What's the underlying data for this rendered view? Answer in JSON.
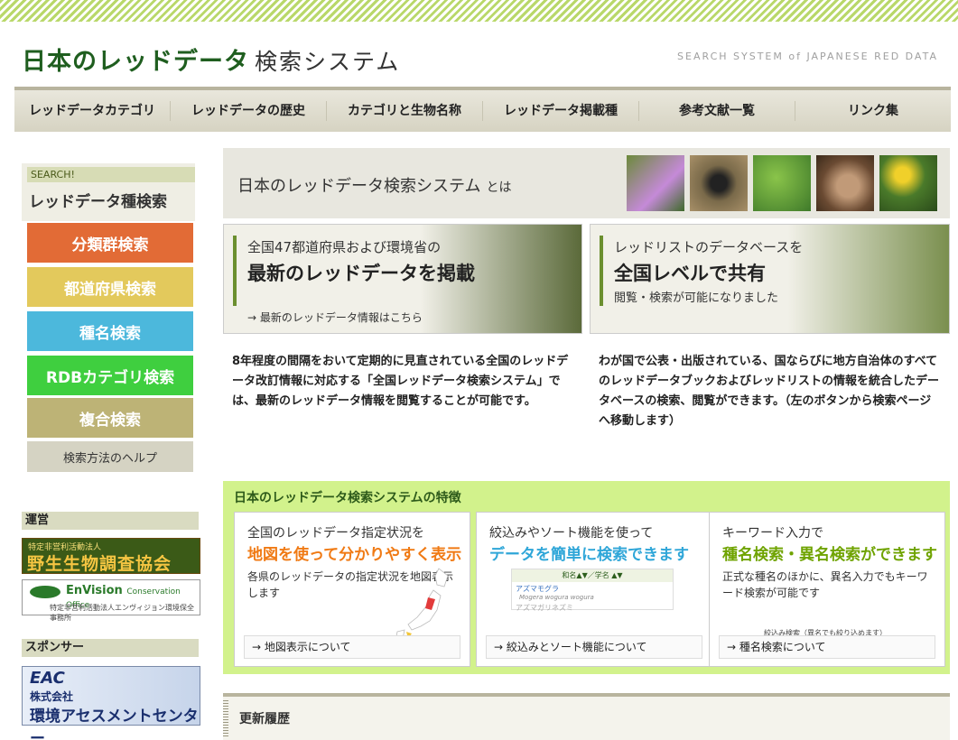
{
  "header": {
    "title": "日本のレッドデータ",
    "title_sub": "検索システム",
    "tagline": "SEARCH SYSTEM of JAPANESE RED DATA"
  },
  "nav": [
    "レッドデータカテゴリ",
    "レッドデータの歴史",
    "カテゴリと生物名称",
    "レッドデータ掲載種",
    "参考文献一覧",
    "リンク集"
  ],
  "sidebar": {
    "search_small": "SEARCH!",
    "search_title": "レッドデータ種検索",
    "buttons": [
      {
        "label": "分類群検索",
        "color": "#e26b36"
      },
      {
        "label": "都道府県検索",
        "color": "#e3c95c"
      },
      {
        "label": "種名検索",
        "color": "#4cb8dc"
      },
      {
        "label": "RDBカテゴリ検索",
        "color": "#3fcf3f"
      },
      {
        "label": "複合検索",
        "color": "#bdb376"
      }
    ],
    "help": "検索方法のヘルプ",
    "operation_head": "運営",
    "operation_banner1_top": "特定非営利活動法人",
    "operation_banner1": "野生生物調査協会",
    "operation_banner2": "EnVision",
    "operation_banner2_small": "Conservation Office",
    "operation_banner2_sub": "特定非営利活動法人エンヴィジョン環境保全事務所",
    "sponsor_head": "スポンサー",
    "sponsor_eac": "EAC",
    "sponsor_company": "株式会社",
    "sponsor_name": "環境アセスメントセンター"
  },
  "hero": {
    "title": "日本のレッドデータ検索システム",
    "title_suffix": "とは"
  },
  "feature_a": {
    "line1": "全国47都道府県および環境省の",
    "line2": "最新のレッドデータを掲載",
    "link": "→ 最新のレッドデータ情報はこちら"
  },
  "feature_b": {
    "line1": "レッドリストのデータベースを",
    "line2": "全国レベルで共有",
    "line3": "閲覧・検索が可能になりました"
  },
  "desc_a": "8年程度の間隔をおいて定期的に見直されている全国のレッドデータ改訂情報に対応する「全国レッドデータ検索システム」では、最新のレッドデータ情報を閲覧することが可能です。",
  "desc_b": "わが国で公表・出版されている、国ならびに地方自治体のすべてのレッドデータブックおよびレッドリストの情報を統合したデータベースの検索、閲覧ができます。（左のボタンから検索ページへ移動します）",
  "features": {
    "heading": "日本のレッドデータ検索システムの特徴",
    "cards": [
      {
        "l1": "全国のレッドデータ指定状況を",
        "l2": "地図を使って分かりやすく表示",
        "l3": "各県のレッドデータの指定状況を地図表示します",
        "link": "→ 地図表示について"
      },
      {
        "l1": "絞込みやソート機能を使って",
        "l2": "データを簡単に検索できます",
        "link": "→ 絞込みとソート機能について",
        "sort_header": "和名▲▼／学名 ▲▼",
        "sort_row1": "アズマモグラ",
        "sort_row1_sci": "Mogera wogura wogura",
        "sort_row2": "アズマガリネズミ"
      },
      {
        "l1": "キーワード入力で",
        "l2": "種名検索・異名検索ができます",
        "l3": "正式な種名のほかに、異名入力でもキーワード検索が可能です",
        "kw_label": "絞込み検索（異名でも絞り込めます）",
        "kw_button": "検索",
        "link": "→ 種名検索について"
      }
    ]
  },
  "updates": {
    "title": "更新履歴"
  }
}
